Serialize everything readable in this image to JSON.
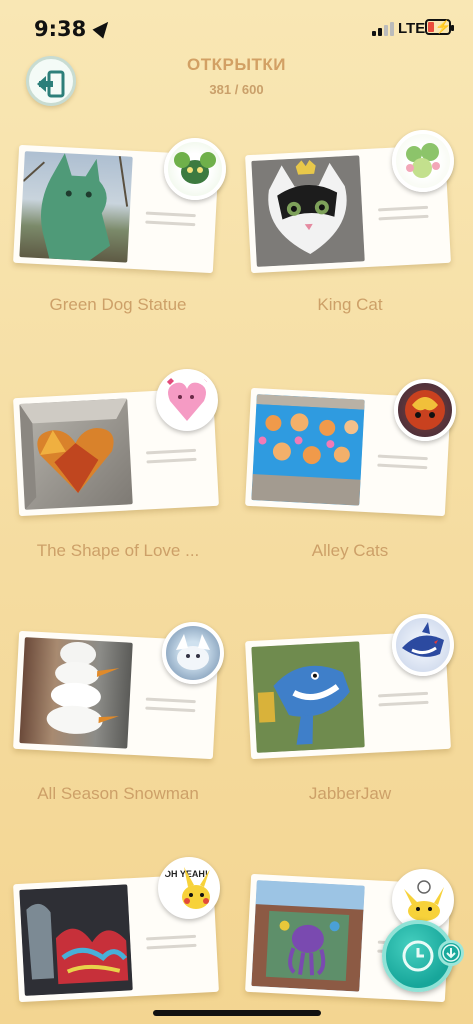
{
  "status_bar": {
    "time": "9:38",
    "network": "LTE"
  },
  "header": {
    "title": "ОТКРЫТКИ",
    "count": "381 / 600"
  },
  "postcards": [
    {
      "label": "Green Dog Statue",
      "photo": "green-dog-statue",
      "sticker": "grass-pokemon-sticker"
    },
    {
      "label": "King Cat",
      "photo": "king-cat-mural",
      "sticker": "flower-pokemon-sticker"
    },
    {
      "label": "The Shape of Love ...",
      "photo": "heart-sculpture",
      "sticker": "pink-heart-pokemon-sticker"
    },
    {
      "label": "Alley Cats",
      "photo": "alley-cats-mural",
      "sticker": "fire-pokemon-sticker"
    },
    {
      "label": "All Season Snowman",
      "photo": "snowman-statue",
      "sticker": "snow-pokemon-sticker"
    },
    {
      "label": "JabberJaw",
      "photo": "shark-mural",
      "sticker": "shark-pokemon-sticker"
    },
    {
      "label": "",
      "photo": "graffiti-wall",
      "sticker": "pikachu-oh-yeah-sticker",
      "sticker_text": "OH YEAH!"
    },
    {
      "label": "",
      "photo": "purple-octopus-mural",
      "sticker": "pikachu-sticker"
    }
  ],
  "colors": {
    "background": "#f7e2a8",
    "label": "#cda068",
    "fab": "#1aa99c"
  }
}
